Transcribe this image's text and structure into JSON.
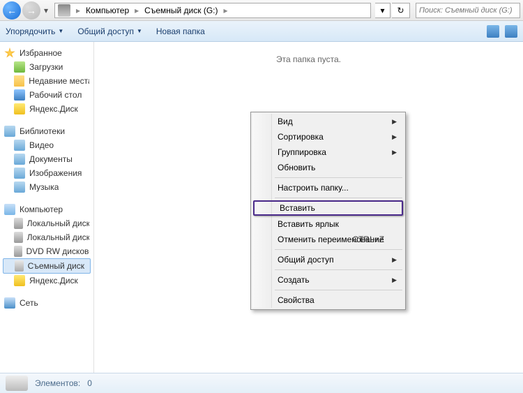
{
  "nav": {
    "breadcrumbs": [
      "Компьютер",
      "Съемный диск (G:)"
    ],
    "search_placeholder": "Поиск: Съемный диск (G:)"
  },
  "toolbar": {
    "organize": "Упорядочить",
    "share": "Общий доступ",
    "new_folder": "Новая папка"
  },
  "sidebar": {
    "favorites": {
      "label": "Избранное",
      "items": [
        "Загрузки",
        "Недавние места",
        "Рабочий стол",
        "Яндекс.Диск"
      ]
    },
    "libraries": {
      "label": "Библиотеки",
      "items": [
        "Видео",
        "Документы",
        "Изображения",
        "Музыка"
      ]
    },
    "computer": {
      "label": "Компьютер",
      "items": [
        "Локальный диск (C:)",
        "Локальный диск (D:)",
        "DVD RW дисковод (E:)",
        "Съемный диск (G:)",
        "Яндекс.Диск"
      ]
    },
    "network": {
      "label": "Сеть"
    }
  },
  "content": {
    "empty": "Эта папка пуста."
  },
  "context_menu": {
    "view": "Вид",
    "sort": "Сортировка",
    "group": "Группировка",
    "refresh": "Обновить",
    "customize": "Настроить папку...",
    "paste": "Вставить",
    "paste_shortcut": "Вставить ярлык",
    "undo_rename": "Отменить переименование",
    "undo_shortcut": "CTRL+Z",
    "share": "Общий доступ",
    "create": "Создать",
    "properties": "Свойства"
  },
  "statusbar": {
    "elements_label": "Элементов:",
    "count": "0"
  }
}
